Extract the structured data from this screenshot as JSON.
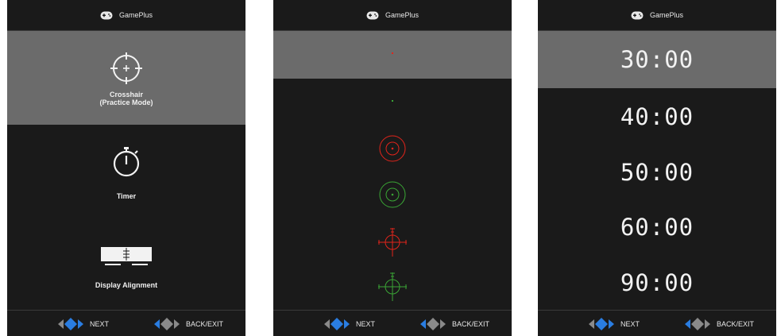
{
  "header_title": "GamePlus",
  "footer": {
    "next_label": "NEXT",
    "back_label": "BACK/EXIT"
  },
  "panels": {
    "main_menu": {
      "items": [
        {
          "label": "Crosshair\n(Practice Mode)",
          "icon": "crosshair-icon",
          "selected": true
        },
        {
          "label": "Timer",
          "icon": "stopwatch-icon",
          "selected": false
        },
        {
          "label": "Display Alignment",
          "icon": "display-alignment-icon",
          "selected": false
        }
      ]
    },
    "crosshair_menu": {
      "items": [
        {
          "icon": "red-dot-crosshair-icon",
          "color": "#e0241b",
          "selected": true
        },
        {
          "icon": "green-dot-crosshair-icon",
          "color": "#3aa535",
          "selected": false
        },
        {
          "icon": "red-circle-crosshair-icon",
          "color": "#e0241b",
          "selected": false
        },
        {
          "icon": "green-circle-crosshair-icon",
          "color": "#3aa535",
          "selected": false
        },
        {
          "icon": "red-scope-crosshair-icon",
          "color": "#e0241b",
          "selected": false
        },
        {
          "icon": "green-scope-crosshair-icon",
          "color": "#3aa535",
          "selected": false
        }
      ]
    },
    "timer_menu": {
      "options": [
        "30:00",
        "40:00",
        "50:00",
        "60:00",
        "90:00"
      ],
      "selected": "30:00"
    }
  },
  "colors": {
    "panel_bg": "#1a1a1a",
    "selection": "#6b6b6b",
    "nav_blue": "#2a7de1",
    "nav_grey": "#8a8a8a"
  }
}
